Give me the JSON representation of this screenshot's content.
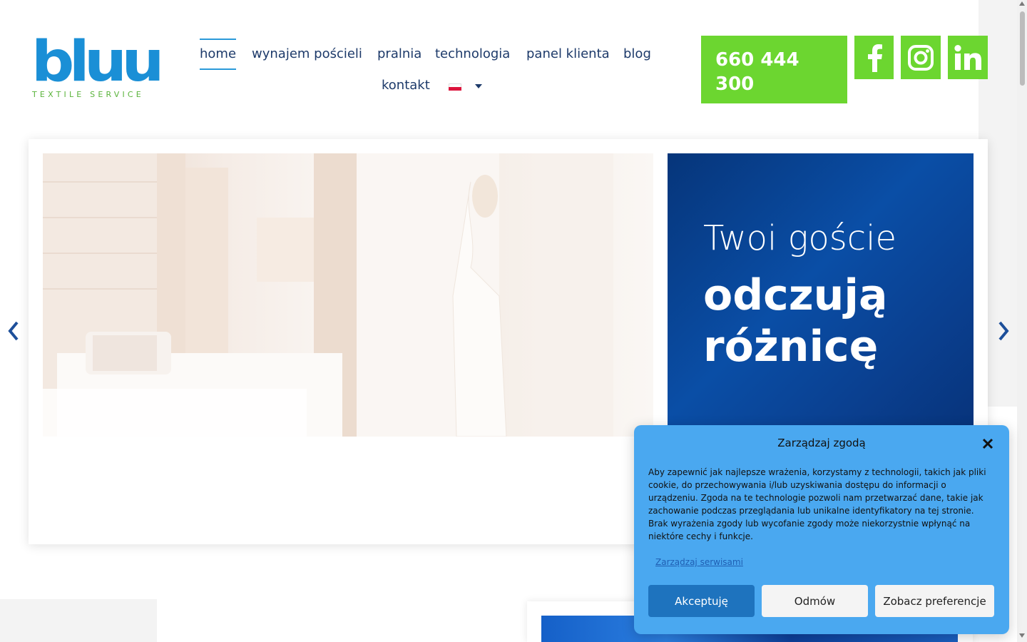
{
  "logo": {
    "word": "bluu",
    "tagline": "TEXTILE SERVICE"
  },
  "nav": {
    "items": [
      {
        "label": "home",
        "active": true
      },
      {
        "label": "wynajem pościeli"
      },
      {
        "label": "pralnia"
      },
      {
        "label": "technologia"
      },
      {
        "label": "panel klienta"
      },
      {
        "label": "blog"
      },
      {
        "label": "kontakt"
      }
    ],
    "language": {
      "flag": "pl-flag-icon",
      "caret": "caret-down-icon"
    }
  },
  "phone": {
    "line1": "660 444",
    "line2": "300"
  },
  "socials": [
    {
      "icon": "facebook-icon"
    },
    {
      "icon": "instagram-icon"
    },
    {
      "icon": "linkedin-icon"
    }
  ],
  "hero": {
    "line1": "Twoi goście",
    "line2": "odczują różnicę",
    "prev_icon": "chevron-left-icon",
    "next_icon": "chevron-right-icon"
  },
  "consent": {
    "title": "Zarządzaj zgodą",
    "text": "Aby zapewnić jak najlepsze wrażenia, korzystamy z technologii, takich jak pliki cookie, do przechowywania i/lub uzyskiwania dostępu do informacji o urządzeniu. Zgoda na te technologie pozwoli nam przetwarzać dane, takie jak zachowanie podczas przeglądania lub unikalne identyfikatory na tej stronie. Brak wyrażenia zgody lub wycofanie zgody może niekorzystnie wpłynąć na niektóre cechy i funkcje.",
    "manage_link": "Zarządzaj serwisami",
    "accept": "Akceptuję",
    "deny": "Odmów",
    "prefs": "Zobacz preferencje"
  },
  "colors": {
    "brand_blue": "#1a8fd6",
    "accent_green": "#6cd630",
    "hero_blue": "#0a4ea6",
    "modal_blue": "#4aa8f0"
  }
}
